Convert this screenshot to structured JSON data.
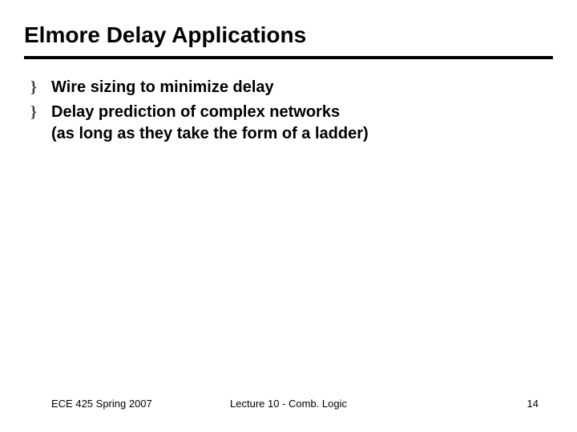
{
  "title": "Elmore Delay Applications",
  "bullets": [
    {
      "glyph": "}",
      "text": "Wire sizing to minimize delay"
    },
    {
      "glyph": "}",
      "text": "Delay prediction of complex networks\n(as long as they take the form of a ladder)"
    }
  ],
  "footer": {
    "left": "ECE 425 Spring 2007",
    "center": "Lecture 10 - Comb. Logic",
    "right": "14"
  }
}
